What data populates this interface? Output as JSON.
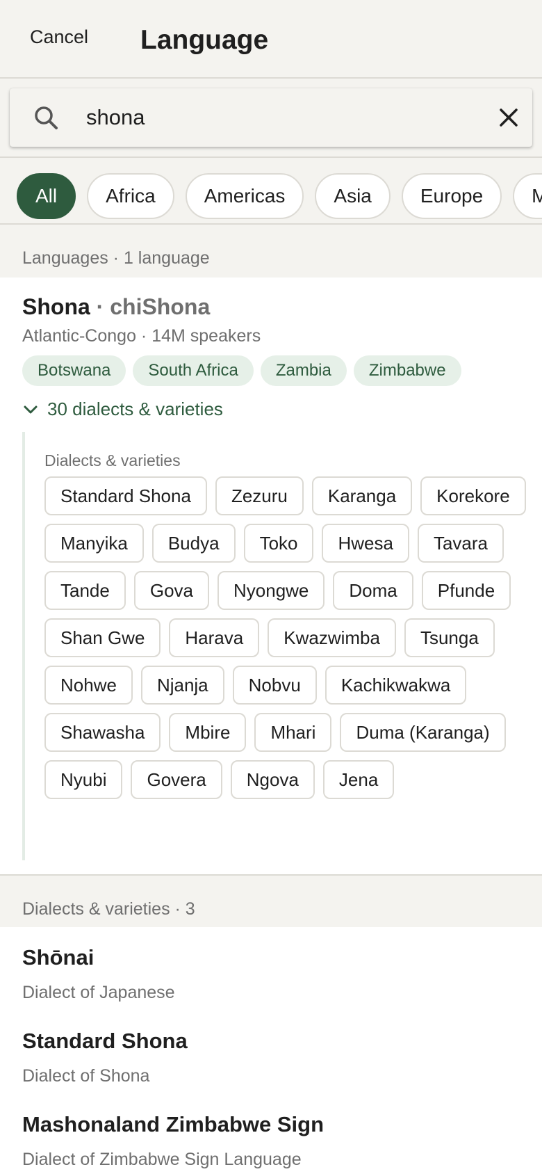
{
  "header": {
    "cancel_label": "Cancel",
    "title": "Language"
  },
  "search": {
    "value": "shona",
    "placeholder": ""
  },
  "filters": [
    "All",
    "Africa",
    "Americas",
    "Asia",
    "Europe",
    "Middle East"
  ],
  "colors": {
    "accent": "#2e5b3e",
    "background": "#f4f3ef",
    "pill_bg": "#e6f0e8"
  },
  "languages_section": {
    "label": "Languages · 1 language"
  },
  "language": {
    "name": "Shona",
    "separator": " · ",
    "native_name": "chiShona",
    "meta": "Atlantic-Congo · 14M speakers",
    "countries": [
      "Botswana",
      "South Africa",
      "Zambia",
      "Zimbabwe"
    ],
    "dialects_toggle": "30 dialects & varieties",
    "dialects_label": "Dialects & varieties",
    "dialects": [
      "Standard Shona",
      "Zezuru",
      "Karanga",
      "Korekore",
      "Manyika",
      "Budya",
      "Toko",
      "Hwesa",
      "Tavara",
      "Tande",
      "Gova",
      "Nyongwe",
      "Doma",
      "Pfunde",
      "Shan Gwe",
      "Harava",
      "Kwazwimba",
      "Tsunga",
      "Nohwe",
      "Njanja",
      "Nobvu",
      "Kachikwakwa",
      "Shawasha",
      "Mbire",
      "Mhari",
      "Duma (Karanga)",
      "Nyubi",
      "Govera",
      "Ngova",
      "Jena"
    ]
  },
  "dialects_section": {
    "label": "Dialects & varieties · 3"
  },
  "results": [
    {
      "title": "Shōnai",
      "subtitle": "Dialect of Japanese"
    },
    {
      "title": "Standard Shona",
      "subtitle": "Dialect of Shona"
    },
    {
      "title": "Mashonaland Zimbabwe Sign",
      "subtitle": "Dialect of Zimbabwe Sign Language"
    }
  ]
}
